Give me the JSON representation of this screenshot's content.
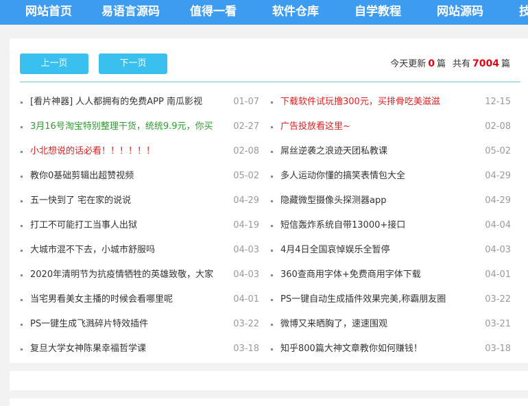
{
  "nav": {
    "items": [
      "网站首页",
      "易语言源码",
      "值得一看",
      "软件仓库",
      "自学教程",
      "网站源码",
      "技"
    ]
  },
  "pager": {
    "prev_label": "上一页",
    "next_label": "下一页"
  },
  "stats": {
    "today_prefix": "今天更新",
    "today_count": "0",
    "today_unit": "篇",
    "total_prefix": "共有",
    "total_count": "7004",
    "total_unit": "篇"
  },
  "colors": {
    "nav_bg": "#3d9bf0",
    "button_bg": "#3ac0ef",
    "count_red": "#e60012",
    "title_red": "#e02020",
    "title_green": "#2e9d2e"
  },
  "articles_left": [
    {
      "title": "[看片神器] 人人都拥有的免费APP 南瓜影视",
      "date": "01-07",
      "color": "#333333"
    },
    {
      "title": "3月16号淘宝特别整理干货，统统9.9元，你买",
      "date": "02-27",
      "color": "#2e9d2e"
    },
    {
      "title": "小北想说的话必看！！！！！！",
      "date": "02-08",
      "color": "#e02020"
    },
    {
      "title": "教你0基础剪辑出超赞视频",
      "date": "05-02",
      "color": "#333333"
    },
    {
      "title": "五一快到了 宅在家的说说",
      "date": "04-29",
      "color": "#333333"
    },
    {
      "title": "打工不可能打工当事人出狱",
      "date": "04-19",
      "color": "#333333"
    },
    {
      "title": "大城市混不下去，小城市舒服吗",
      "date": "04-03",
      "color": "#333333"
    },
    {
      "title": "2020年清明节为抗疫情牺牲的英雄致敬，大家",
      "date": "04-03",
      "color": "#333333"
    },
    {
      "title": "当宅男看美女主播的时候会看哪里呢",
      "date": "04-01",
      "color": "#333333"
    },
    {
      "title": "PS一键生成飞溅碎片特效插件",
      "date": "03-22",
      "color": "#333333"
    },
    {
      "title": "复旦大学女神陈果幸福哲学课",
      "date": "03-18",
      "color": "#333333"
    }
  ],
  "articles_right": [
    {
      "title": "下载软件试玩撸300元，买排骨吃美滋滋",
      "date": "12-15",
      "color": "#e02020"
    },
    {
      "title": "广告投放看这里~",
      "date": "02-08",
      "color": "#e02020"
    },
    {
      "title": "屌丝逆袭之浪迹天团私教课",
      "date": "05-02",
      "color": "#333333"
    },
    {
      "title": "多人运动你懂的搞笑表情包大全",
      "date": "04-29",
      "color": "#333333"
    },
    {
      "title": "隐藏微型摄像头探测器app",
      "date": "04-29",
      "color": "#333333"
    },
    {
      "title": "短信轰炸系统自带13000+接口",
      "date": "04-04",
      "color": "#333333"
    },
    {
      "title": "4月4日全国哀悼娱乐全暂停",
      "date": "04-03",
      "color": "#333333"
    },
    {
      "title": "360查商用字体+免费商用字体下载",
      "date": "04-01",
      "color": "#333333"
    },
    {
      "title": "PS一键自动生成插件效果完美,称霸朋友圈",
      "date": "03-22",
      "color": "#333333"
    },
    {
      "title": "微博又来晒胸了，速速围观",
      "date": "03-21",
      "color": "#333333"
    },
    {
      "title": "知乎800篇大神文章教你如何赚钱！",
      "date": "03-18",
      "color": "#333333"
    }
  ]
}
